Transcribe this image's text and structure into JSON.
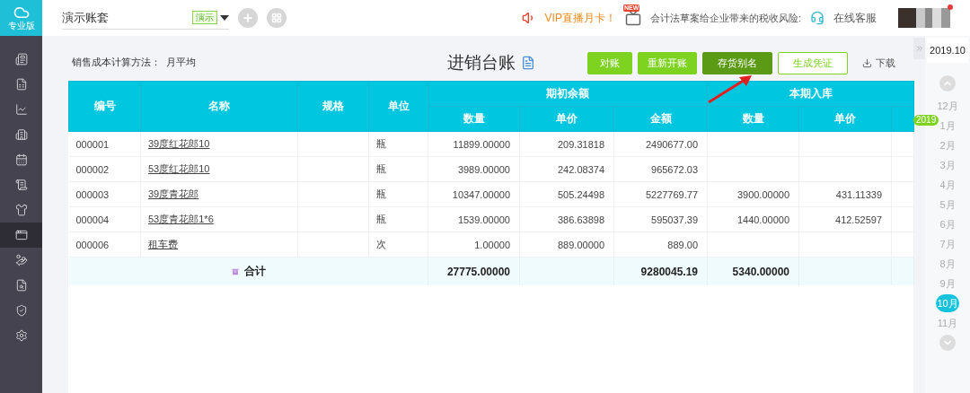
{
  "logo": {
    "label": "专业版"
  },
  "sidebar": {
    "items": [
      {
        "selected": false
      },
      {
        "selected": false
      },
      {
        "selected": false
      },
      {
        "selected": false
      },
      {
        "selected": false
      },
      {
        "selected": false
      },
      {
        "selected": false
      },
      {
        "selected": true
      },
      {
        "selected": false
      },
      {
        "selected": false
      },
      {
        "selected": false
      },
      {
        "selected": false
      }
    ]
  },
  "topbar": {
    "account": "演示账套",
    "account_tag": "演示",
    "promo": "VIP直播月卡！",
    "news_badge": "NEW",
    "news": "会计法草案给企业带来的税收风险:",
    "support": "在线客服"
  },
  "cost_method": {
    "label": "销售成本计算方法：",
    "value": "月平均"
  },
  "title": "进销台账",
  "buttons": [
    {
      "label": "对账",
      "kind": "primary"
    },
    {
      "label": "重新开账",
      "kind": "primary"
    },
    {
      "label": "存货别名",
      "kind": "dark"
    },
    {
      "label": "生成凭证",
      "kind": "outline"
    }
  ],
  "download": "下载",
  "table": {
    "fixed_columns": [
      "编号",
      "名称",
      "规格",
      "单位"
    ],
    "groups": [
      {
        "title": "期初余额",
        "columns": [
          "数量",
          "单价",
          "金额"
        ]
      },
      {
        "title": "本期入库",
        "columns": [
          "数量",
          "单价"
        ]
      }
    ],
    "rows": [
      {
        "code": "000001",
        "name": "39度红花郎10",
        "unit": "瓶",
        "opening_qty": "11899.00000",
        "opening_price": "209.31818",
        "opening_amount": "2490677.00"
      },
      {
        "code": "000002",
        "name": "53度红花郎10",
        "unit": "瓶",
        "opening_qty": "3989.00000",
        "opening_price": "242.08374",
        "opening_amount": "965672.03"
      },
      {
        "code": "000003",
        "name": "39度青花郎",
        "unit": "瓶",
        "opening_qty": "10347.00000",
        "opening_price": "505.24498",
        "opening_amount": "5227769.77",
        "in_qty": "3900.00000",
        "in_price": "431.11339"
      },
      {
        "code": "000004",
        "name": "53度青花郎1*6",
        "unit": "瓶",
        "opening_qty": "1539.00000",
        "opening_price": "386.63898",
        "opening_amount": "595037.39",
        "in_qty": "1440.00000",
        "in_price": "412.52597"
      },
      {
        "code": "000006",
        "name": "租车费",
        "unit": "次",
        "opening_qty": "1.00000",
        "opening_price": "889.00000",
        "opening_amount": "889.00"
      }
    ],
    "total": {
      "label": "合计",
      "opening_qty": "27775.00000",
      "opening_amount": "9280045.19",
      "in_qty": "5340.00000"
    }
  },
  "period": {
    "current": "2019.10",
    "year_badge": "2019",
    "months": [
      {
        "label": "12月",
        "selected": false
      },
      {
        "label": "1月",
        "selected": false
      },
      {
        "label": "2月",
        "selected": false
      },
      {
        "label": "3月",
        "selected": false
      },
      {
        "label": "4月",
        "selected": false
      },
      {
        "label": "5月",
        "selected": false
      },
      {
        "label": "6月",
        "selected": false
      },
      {
        "label": "7月",
        "selected": false
      },
      {
        "label": "8月",
        "selected": false
      },
      {
        "label": "9月",
        "selected": false
      },
      {
        "label": "10月",
        "selected": true
      },
      {
        "label": "11月",
        "selected": false
      }
    ]
  }
}
